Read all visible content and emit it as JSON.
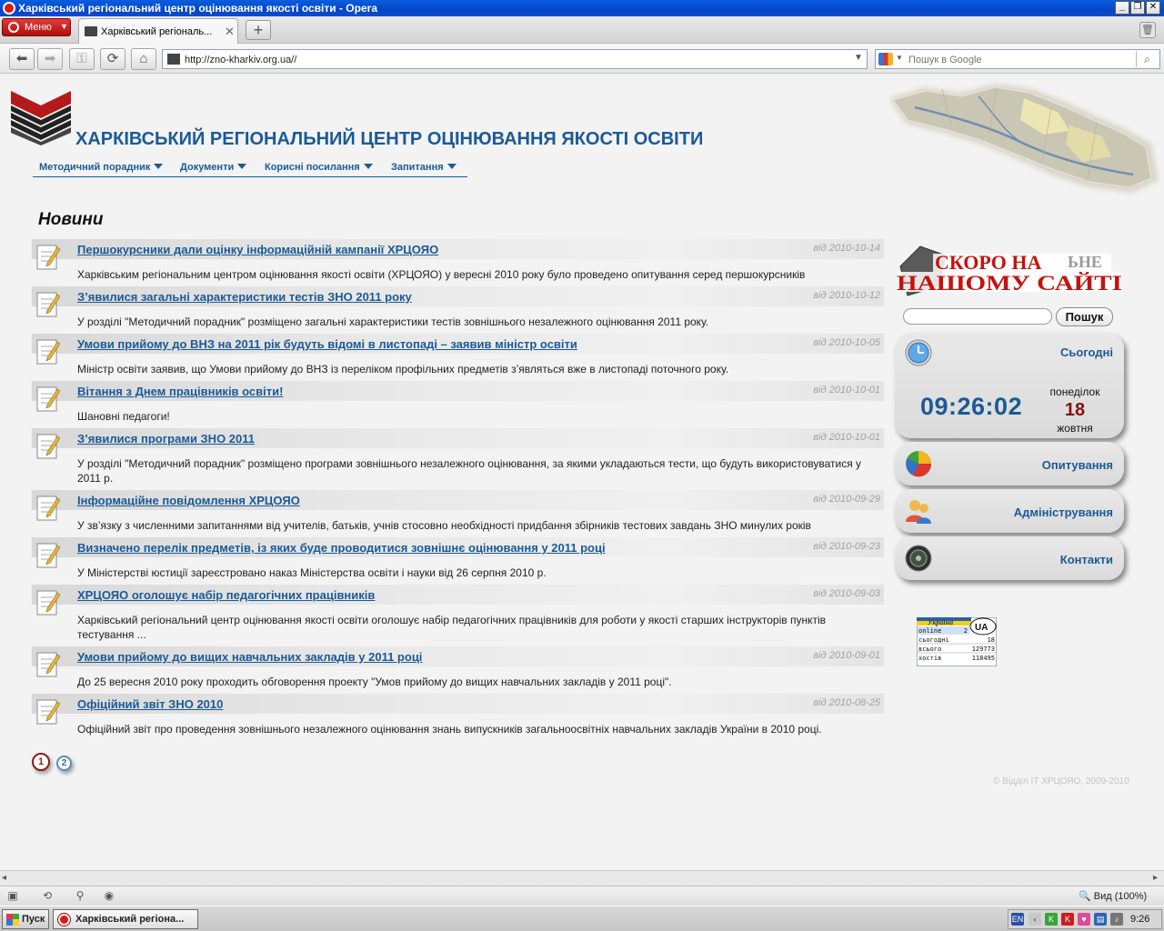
{
  "window": {
    "title": "Харківський регіональний центр оцінювання якості освіти - Opera"
  },
  "browser": {
    "menu_label": "Меню",
    "tab_title": "Харківський регіональ...",
    "url": "http://zno-kharkiv.org.ua//",
    "search_placeholder": "Пошук в Google",
    "zoom_label": "Вид (100%)"
  },
  "site": {
    "title": "ХАРКІВСЬКИЙ РЕГІОНАЛЬНИЙ ЦЕНТР ОЦІНЮВАННЯ ЯКОСТІ ОСВІТИ",
    "nav": [
      "Методичний порадник",
      "Документи",
      "Корисні посилання",
      "Запитання"
    ],
    "news_heading": "Новини",
    "copyright": "© Відділ ІТ ХРЦОЯО, 2009-2010"
  },
  "news": [
    {
      "title": "Першокурсники дали оцінку інформаційній кампанії ХРЦОЯО",
      "date": "від 2010-10-14",
      "desc": "Харківським регіональним центром оцінювання якості освіти (ХРЦОЯО) у вересні 2010 року було проведено опитування серед першокурсників"
    },
    {
      "title": "З’явилися загальні характеристики тестів ЗНО 2011 року",
      "date": "від 2010-10-12",
      "desc": "У розділі \"Методичний порадник\" розміщено загальні характеристики тестів зовнішнього незалежного оцінювання 2011 року."
    },
    {
      "title": "Умови прийому до ВНЗ на 2011 рік будуть відомі в листопаді – заявив міністр освіти",
      "date": "від 2010-10-05",
      "desc": "Міністр освіти заявив, що Умови прийому до ВНЗ із переліком профільних предметів з’являться вже в листопаді поточного року."
    },
    {
      "title": "Вітання з Днем працівників освіти!",
      "date": "від 2010-10-01",
      "desc": "Шановні педагоги!"
    },
    {
      "title": "З’явилися програми ЗНО 2011",
      "date": "від 2010-10-01",
      "desc": "У розділі \"Методичний порадник\" розміщено програми зовнішнього незалежного оцінювання, за якими укладаються тести, що будуть використовуватися у 2011 р."
    },
    {
      "title": "Інформаційне повідомлення ХРЦОЯО",
      "date": "від 2010-09-29",
      "desc": "У зв’язку з численними запитаннями від учителів, батьків, учнів стосовно необхідності придбання збірників тестових завдань ЗНО минулих років"
    },
    {
      "title": "Визначено перелік предметів, із яких буде проводитися зовнішнє оцінювання у 2011 році",
      "date": "від 2010-09-23",
      "desc": "У Міністерстві юстиції зареєстровано наказ Міністерства освіти і науки від 26 серпня 2010 р."
    },
    {
      "title": "ХРЦОЯО оголошує набір педагогічних працівників",
      "date": "від 2010-09-03",
      "desc": "Харківський регіональний центр оцінювання якості освіти оголошує набір педагогічних працівників для роботи у якості старших інструкторів пунктів тестування ..."
    },
    {
      "title": "Умови прийому до вищих навчальних закладів у 2011 році",
      "date": "від 2010-09-01",
      "desc": "До 25 вересня 2010 року проходить обговорення проекту \"Умов прийому до вищих навчальних закладів у 2011 році\"."
    },
    {
      "title": "Офіційний звіт ЗНО 2010",
      "date": "від 2010-08-25",
      "desc": "Офіційний звіт про проведення зовнішнього незалежного оцінювання знань випускників загальноосвітніх навчальних закладів України в 2010 році."
    }
  ],
  "pagination": [
    "1",
    "2"
  ],
  "sidebar": {
    "banner_line1": "СКОРО НА",
    "banner_line2": "НАШОМУ САЙТІ",
    "banner_aside": "ЬНЕ",
    "search_button": "Пошук",
    "today_label": "Сьогодні",
    "time": "09:26:02",
    "weekday": "понеділок",
    "day": "18",
    "month": "жовтня",
    "poll_label": "Опитування",
    "admin_label": "Адміністрування",
    "contacts_label": "Контакти"
  },
  "counter": {
    "brand": "Україна",
    "badge": "UA",
    "rows": [
      {
        "label": "online",
        "value": "2"
      },
      {
        "label": "сьогодні",
        "value": "18"
      },
      {
        "label": "всього",
        "value": "129773"
      },
      {
        "label": "хостів",
        "value": "118495"
      }
    ]
  },
  "taskbar": {
    "start_label": "Пуск",
    "task_label": "Харківський регіона...",
    "lang": "EN",
    "time": "9:26"
  },
  "colors": {
    "brand_blue": "#1b5a95",
    "accent_red": "#8b1010"
  }
}
